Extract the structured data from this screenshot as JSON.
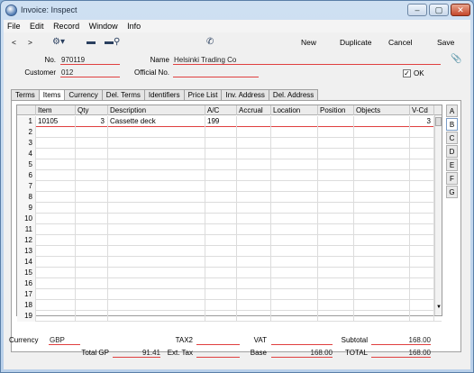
{
  "window": {
    "title": "Invoice: Inspect",
    "controls": [
      "–",
      "▢",
      "✕"
    ]
  },
  "menu": [
    "File",
    "Edit",
    "Record",
    "Window",
    "Info"
  ],
  "toolbar": {
    "prev": "<",
    "next": ">",
    "new": "New",
    "duplicate": "Duplicate",
    "cancel": "Cancel",
    "save": "Save"
  },
  "header": {
    "no_label": "No.",
    "no_value": "970119",
    "name_label": "Name",
    "name_value": "Helsinki Trading Co",
    "customer_label": "Customer",
    "customer_value": "012",
    "official_label": "Official No.",
    "official_value": "",
    "ok_label": "OK",
    "ok_checked": "✓"
  },
  "tabs": [
    "Terms",
    "Items",
    "Currency",
    "Del. Terms",
    "Identifiers",
    "Price List",
    "Inv. Address",
    "Del. Address"
  ],
  "grid": {
    "columns": [
      "Item",
      "Qty",
      "Description",
      "A/C",
      "Accrual",
      "Location",
      "Position",
      "Objects",
      "V-Cd"
    ],
    "rows": [
      {
        "num": "1",
        "item": "10105",
        "qty": "3",
        "description": "Cassette deck",
        "ac": "199",
        "vcd": "3"
      },
      {
        "num": "2"
      },
      {
        "num": "3"
      },
      {
        "num": "4"
      },
      {
        "num": "5"
      },
      {
        "num": "6"
      },
      {
        "num": "7"
      },
      {
        "num": "8"
      },
      {
        "num": "9"
      },
      {
        "num": "10"
      },
      {
        "num": "11"
      },
      {
        "num": "12"
      },
      {
        "num": "13"
      },
      {
        "num": "14"
      },
      {
        "num": "15"
      },
      {
        "num": "16"
      },
      {
        "num": "17"
      },
      {
        "num": "18"
      },
      {
        "num": "19"
      }
    ]
  },
  "side_tabs": [
    "A",
    "B",
    "C",
    "D",
    "E",
    "F",
    "G"
  ],
  "footer": {
    "currency_label": "Currency",
    "currency_value": "GBP",
    "tax2_label": "TAX2",
    "tax2_value": "",
    "vat_label": "VAT",
    "vat_value": "",
    "subtotal_label": "Subtotal",
    "subtotal_value": "168.00",
    "totalgp_label": "Total GP",
    "totalgp_value": "91.41",
    "exttax_label": "Ext. Tax",
    "exttax_value": "",
    "base_label": "Base",
    "base_value": "168.00",
    "total_label": "TOTAL",
    "total_value": "168.00"
  }
}
